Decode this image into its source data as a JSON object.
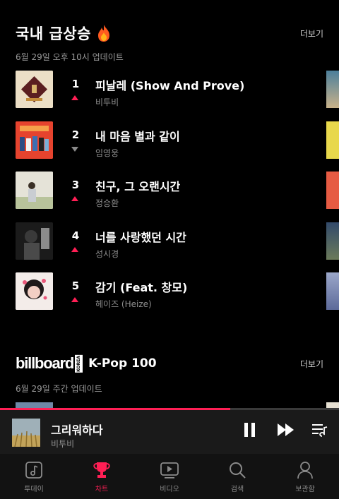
{
  "hot": {
    "title": "국내 급상승",
    "more": "더보기",
    "updated": "6월 29일 오후 10시 업데이트",
    "items": [
      {
        "rank": "1",
        "title": "피날레 (Show And Prove)",
        "artist": "비투비",
        "trend": "up"
      },
      {
        "rank": "2",
        "title": "내 마음 별과 같이",
        "artist": "임영웅",
        "trend": "down"
      },
      {
        "rank": "3",
        "title": "친구, 그 오랜시간",
        "artist": "정승환",
        "trend": "up"
      },
      {
        "rank": "4",
        "title": "너를 사랑했던 시간",
        "artist": "성시경",
        "trend": "up"
      },
      {
        "rank": "5",
        "title": "감기 (Feat. 창모)",
        "artist": "헤이즈 (Heize)",
        "trend": "up"
      }
    ]
  },
  "billboard": {
    "logo": "billboard",
    "logo_tag": "KOREA",
    "title": "K-Pop 100",
    "more": "더보기",
    "updated": "6월 29일 주간 업데이트"
  },
  "player": {
    "title": "그리워하다",
    "artist": "비투비",
    "progress": 0.68
  },
  "tabs": [
    {
      "label": "투데이",
      "icon": "music-note-icon",
      "active": false
    },
    {
      "label": "차트",
      "icon": "trophy-icon",
      "active": true
    },
    {
      "label": "비디오",
      "icon": "video-play-icon",
      "active": false
    },
    {
      "label": "검색",
      "icon": "search-icon",
      "active": false
    },
    {
      "label": "보관함",
      "icon": "person-icon",
      "active": false
    }
  ],
  "colors": {
    "accent": "#ff1f55",
    "background": "#000000"
  }
}
